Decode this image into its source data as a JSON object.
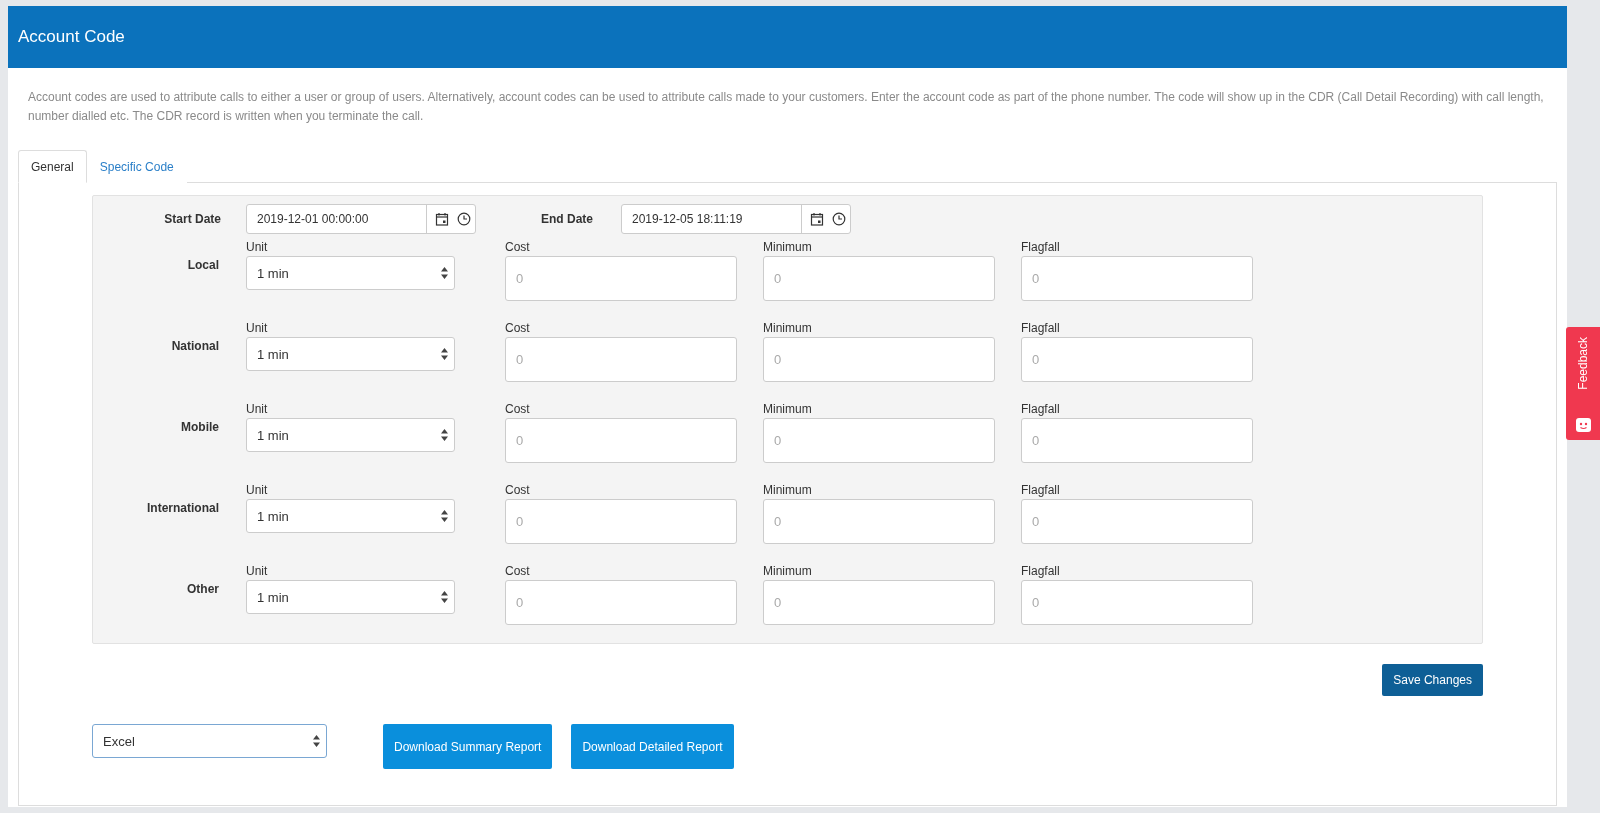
{
  "header": {
    "title": "Account Code"
  },
  "description": "Account codes are used to attribute calls to either a user or group of users. Alternatively, account codes can be used to attribute calls made to your customers. Enter the account code as part of the phone number. The code will show up in the CDR (Call Detail Recording) with call length, number dialled etc. The CDR record is written when you terminate the call.",
  "tabs": [
    {
      "label": "General",
      "selected": true
    },
    {
      "label": "Specific Code",
      "selected": false
    }
  ],
  "dates": [
    {
      "label": "Start Date",
      "value": "2019-12-01 00:00:00"
    },
    {
      "label": "End Date",
      "value": "2019-12-05 18:11:19"
    }
  ],
  "rates": [
    {
      "label": "Local",
      "fields": [
        {
          "kind": "select",
          "label": "Unit",
          "value": "1 min"
        },
        {
          "kind": "input",
          "label": "Cost",
          "placeholder": "0"
        },
        {
          "kind": "input",
          "label": "Minimum",
          "placeholder": "0"
        },
        {
          "kind": "input",
          "label": "Flagfall",
          "placeholder": "0"
        }
      ]
    },
    {
      "label": "National",
      "fields": [
        {
          "kind": "select",
          "label": "Unit",
          "value": "1 min"
        },
        {
          "kind": "input",
          "label": "Cost",
          "placeholder": "0"
        },
        {
          "kind": "input",
          "label": "Minimum",
          "placeholder": "0"
        },
        {
          "kind": "input",
          "label": "Flagfall",
          "placeholder": "0"
        }
      ]
    },
    {
      "label": "Mobile",
      "fields": [
        {
          "kind": "select",
          "label": "Unit",
          "value": "1 min"
        },
        {
          "kind": "input",
          "label": "Cost",
          "placeholder": "0"
        },
        {
          "kind": "input",
          "label": "Minimum",
          "placeholder": "0"
        },
        {
          "kind": "input",
          "label": "Flagfall",
          "placeholder": "0"
        }
      ]
    },
    {
      "label": "International",
      "fields": [
        {
          "kind": "select",
          "label": "Unit",
          "value": "1 min"
        },
        {
          "kind": "input",
          "label": "Cost",
          "placeholder": "0"
        },
        {
          "kind": "input",
          "label": "Minimum",
          "placeholder": "0"
        },
        {
          "kind": "input",
          "label": "Flagfall",
          "placeholder": "0"
        }
      ]
    },
    {
      "label": "Other",
      "fields": [
        {
          "kind": "select",
          "label": "Unit",
          "value": "1 min"
        },
        {
          "kind": "input",
          "label": "Cost",
          "placeholder": "0"
        },
        {
          "kind": "input",
          "label": "Minimum",
          "placeholder": "0"
        },
        {
          "kind": "input",
          "label": "Flagfall",
          "placeholder": "0"
        }
      ]
    }
  ],
  "save_button": "Save Changes",
  "export": {
    "format": "Excel",
    "buttons": [
      "Download Summary Report",
      "Download Detailed Report"
    ]
  },
  "feedback": "Feedback"
}
